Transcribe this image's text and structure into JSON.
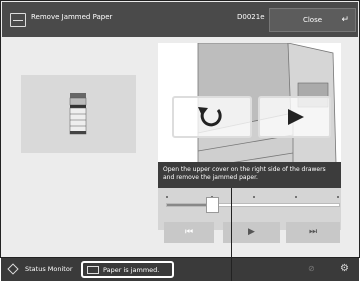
{
  "header": {
    "title": "Remove Jammed Paper",
    "code": "D0021e",
    "close_label": "Close",
    "return_glyph": "↵"
  },
  "guide": {
    "caption": "Open the upper cover on the right side of the drawers and remove the jammed paper.",
    "progress": 0.3,
    "controls": {
      "previous": "⏮",
      "play": "▶",
      "next": "⏭"
    }
  },
  "status_bar": {
    "monitor_label": "Status Monitor",
    "message": "Paper is jammed."
  },
  "icons": [
    "document-icon",
    "replay-icon",
    "play-icon",
    "previous-icon",
    "next-icon",
    "status-monitor-icon",
    "paper-jam-icon",
    "settings-icon"
  ]
}
